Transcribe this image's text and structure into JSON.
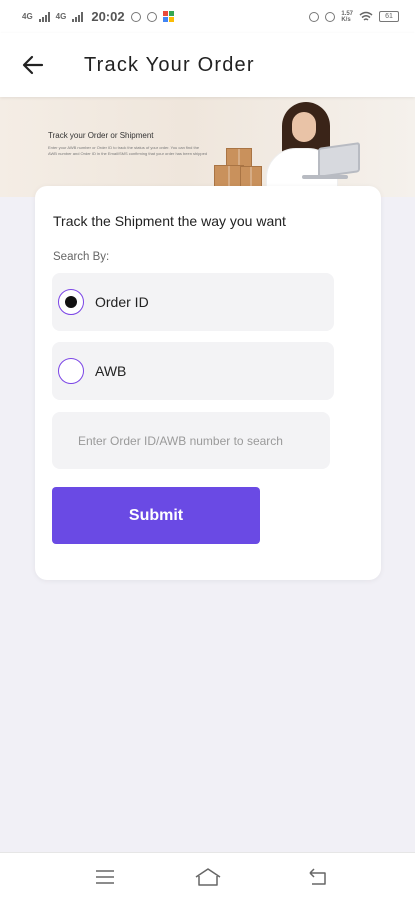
{
  "status_bar": {
    "signal_1_label": "4G",
    "signal_2_label": "4G",
    "time": "20:02",
    "network_speed": "1.57\nK/s",
    "battery": "61"
  },
  "app_bar": {
    "back_icon": "arrow-left-icon",
    "title": "Track Your Order"
  },
  "banner": {
    "heading": "Track your Order or Shipment",
    "text": "Enter your AWB number or Order ID to track the status of your order. You can find the AWB number and Order ID in the Email/SMS confirming that your order has been shipped"
  },
  "form": {
    "title": "Track the Shipment the way you want",
    "search_by_label": "Search By:",
    "options": [
      {
        "label": "Order ID",
        "selected": true
      },
      {
        "label": "AWB",
        "selected": false
      }
    ],
    "search_input": {
      "value": "",
      "placeholder": "Enter Order ID/AWB number to search"
    },
    "submit_label": "Submit"
  },
  "nav_bar": {
    "items": [
      "menu-icon",
      "home-icon",
      "back-icon"
    ]
  },
  "colors": {
    "accent": "#6a4ae4",
    "radio_border": "#7b45e6",
    "background": "#f1f0f6"
  }
}
